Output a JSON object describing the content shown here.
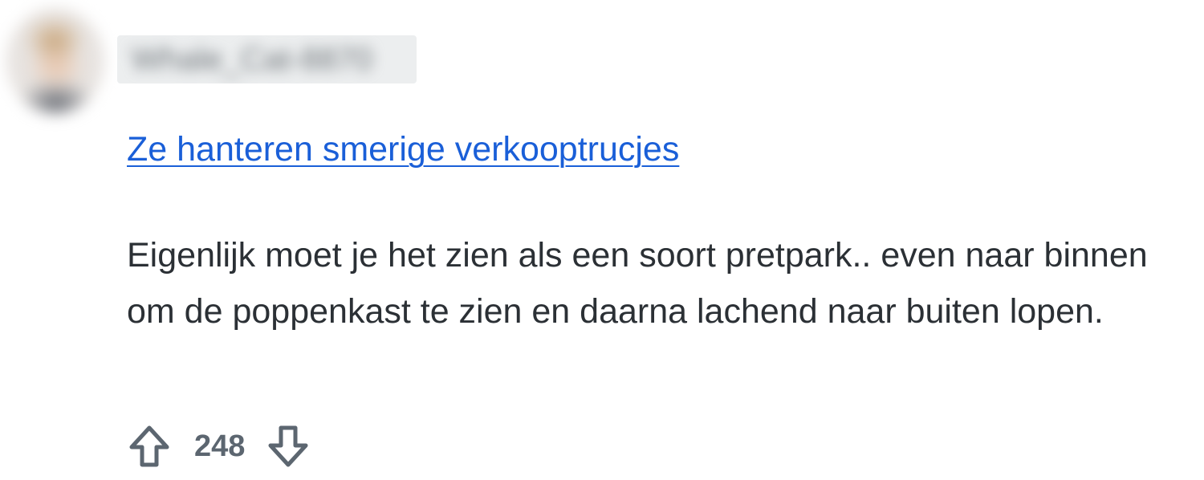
{
  "comment": {
    "avatar": {
      "icon": "user-avatar",
      "description_visible": false
    },
    "username": "Whale_Cat-8870",
    "link_title": "Ze hanteren smerige verkooptrucjes",
    "body": "Eigenlijk moet je het zien als een soort pretpark.. even naar binnen om de poppenkast te zien en daarna lachend naar buiten lopen.",
    "votes": {
      "score": "248",
      "upvote_icon": "arrow-up-icon",
      "downvote_icon": "arrow-down-icon"
    }
  },
  "colors": {
    "link": "#1a5fd8",
    "text": "#2b3035",
    "vote": "#5c6670",
    "username_placeholder": "#eceeef"
  }
}
